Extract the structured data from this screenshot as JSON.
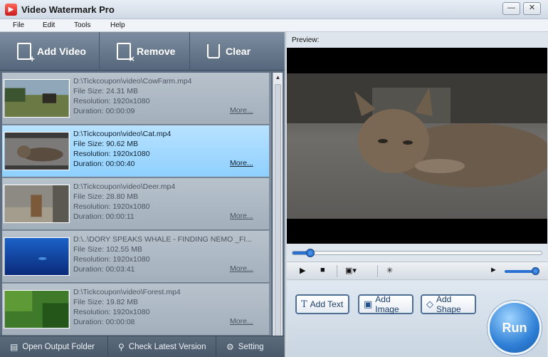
{
  "window": {
    "title": "Video Watermark Pro",
    "icon": "app-logo-icon",
    "buttons": [
      "minimize-icon",
      "close-icon"
    ]
  },
  "menu": [
    "File",
    "Edit",
    "Tools",
    "Help"
  ],
  "toolbar": {
    "add_video": "Add Video",
    "remove": "Remove",
    "clear": "Clear"
  },
  "videos": [
    {
      "path": "D:\\Tickcoupon\\video\\CowFarm.mp4",
      "size": "File Size: 24.31 MB",
      "resolution": "Resolution: 1920x1080",
      "duration": "Duration: 00:00:09",
      "more": "More...",
      "selected": false
    },
    {
      "path": "D:\\Tickcoupon\\video\\Cat.mp4",
      "size": "File Size: 90.62 MB",
      "resolution": "Resolution: 1920x1080",
      "duration": "Duration: 00:00:40",
      "more": "More...",
      "selected": true
    },
    {
      "path": "D:\\Tickcoupon\\video\\Deer.mp4",
      "size": "File Size: 28.80 MB",
      "resolution": "Resolution: 1920x1080",
      "duration": "Duration: 00:00:11",
      "more": "More...",
      "selected": false
    },
    {
      "path": "D:\\..\\DORY SPEAKS WHALE - FINDING NEMO _FI...",
      "size": "File Size: 102.55 MB",
      "resolution": "Resolution: 1920x1080",
      "duration": "Duration: 00:03:41",
      "more": "More...",
      "selected": false
    },
    {
      "path": "D:\\Tickcoupon\\video\\Forest.mp4",
      "size": "File Size: 19.82 MB",
      "resolution": "Resolution: 1920x1080",
      "duration": "Duration: 00:00:08",
      "more": "More...",
      "selected": false
    }
  ],
  "bottom": {
    "open_folder": "Open Output Folder",
    "check_version": "Check Latest Version",
    "setting": "Setting"
  },
  "preview": {
    "label": "Preview:",
    "progress": 0.07,
    "volume": 0.9
  },
  "actions": {
    "add_text": "Add Text",
    "add_image": "Add Image",
    "add_shape": "Add Shape",
    "run": "Run"
  },
  "colors": {
    "selected_row": "#8fd0ff",
    "accent": "#2a6fd2",
    "panel": "#5d6d7f"
  }
}
